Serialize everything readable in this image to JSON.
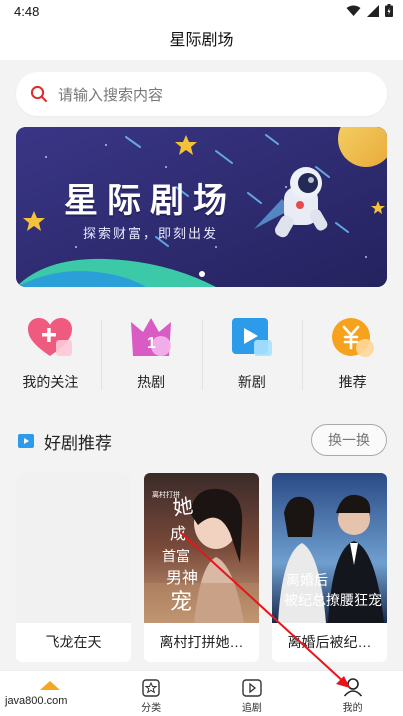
{
  "status_bar": {
    "time": "4:48"
  },
  "header": {
    "title": "星际剧场"
  },
  "search": {
    "placeholder": "请输入搜索内容"
  },
  "banner": {
    "title": "星际剧场",
    "subtitle": "探索财富，即刻出发"
  },
  "quick_nav": [
    {
      "label": "我的关注",
      "icon": "heart-plus-icon"
    },
    {
      "label": "热剧",
      "icon": "crown-one-icon"
    },
    {
      "label": "新剧",
      "icon": "play-icon"
    },
    {
      "label": "推荐",
      "icon": "yen-coin-icon"
    }
  ],
  "section": {
    "title": "好剧推荐",
    "shuffle_label": "换一换"
  },
  "cards": [
    {
      "title": "飞龙在天",
      "poster_text": ""
    },
    {
      "title": "离村打拼她…",
      "poster_text": "她成为了首富男神心尖宠"
    },
    {
      "title": "离婚后被纪…",
      "poster_text": "离婚后被纪总撩腰狂宠"
    }
  ],
  "bottom_nav": {
    "home_watermark": "java800.com",
    "tabs": [
      {
        "label": ""
      },
      {
        "label": "分类"
      },
      {
        "label": "追剧"
      },
      {
        "label": "我的"
      }
    ]
  },
  "colors": {
    "accent": "#f5a623",
    "arrow": "#e8141b",
    "banner_bg": "#2c2a6e"
  }
}
